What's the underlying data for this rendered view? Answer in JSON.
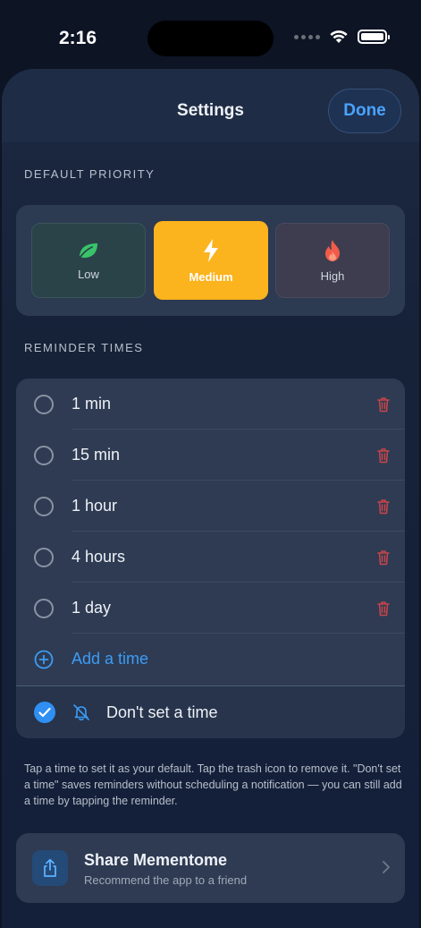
{
  "status": {
    "time": "2:16"
  },
  "header": {
    "title": "Settings",
    "done_label": "Done"
  },
  "priority": {
    "section_label": "DEFAULT PRIORITY",
    "options": [
      {
        "label": "Low",
        "icon": "leaf-icon",
        "color": "#39c46a"
      },
      {
        "label": "Medium",
        "icon": "lightning-icon",
        "color": "#fbb31e",
        "selected": true
      },
      {
        "label": "High",
        "icon": "flame-icon",
        "color": "#f15b4a"
      }
    ]
  },
  "reminders": {
    "section_label": "REMINDER TIMES",
    "items": [
      {
        "label": "1 min"
      },
      {
        "label": "15 min"
      },
      {
        "label": "1 hour"
      },
      {
        "label": "4 hours"
      },
      {
        "label": "1 day"
      }
    ],
    "add_label": "Add a time",
    "no_time_label": "Don't set a time"
  },
  "footnote": "Tap a time to set it as your default. Tap the trash icon to remove it. \"Don't set a time\" saves reminders without scheduling a notification — you can still add a time by tapping the reminder.",
  "share": {
    "title": "Share Mementome",
    "subtitle": "Recommend the app to a friend"
  },
  "colors": {
    "accent": "#3c9cf5",
    "trash": "#c9454a",
    "medium": "#fbb31e"
  }
}
